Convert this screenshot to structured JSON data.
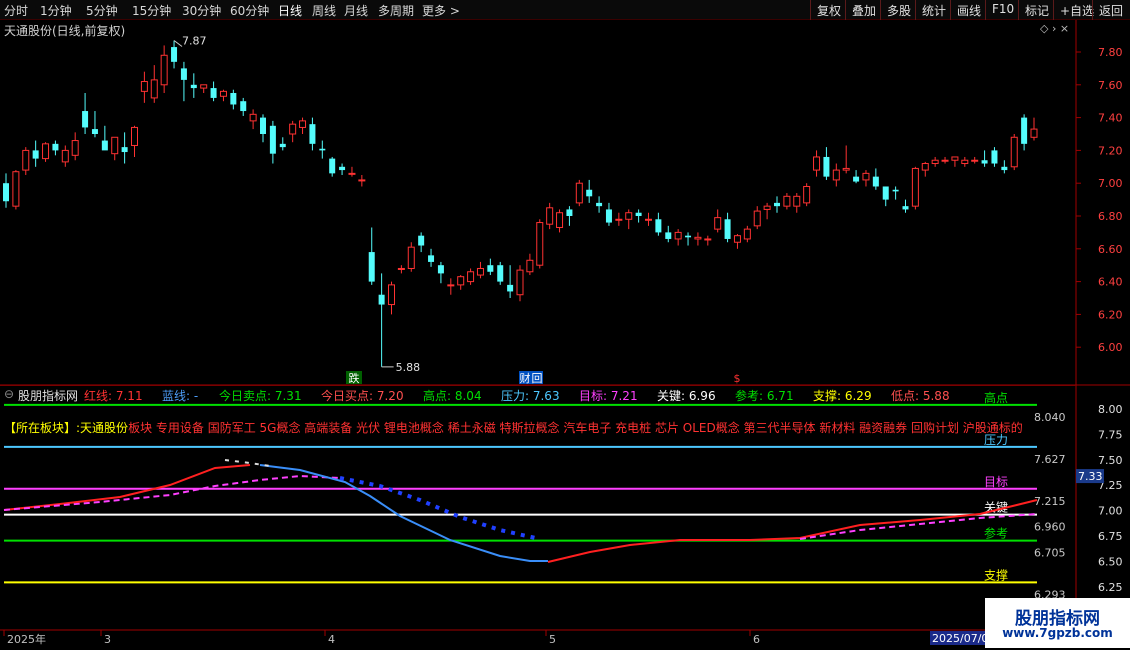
{
  "toolbar": {
    "left_items": [
      "分时",
      "1分钟",
      "5分钟",
      "15分钟",
      "30分钟",
      "60分钟",
      "日线",
      "周线",
      "月线",
      "多周期",
      "更多"
    ],
    "right_items": [
      "复权",
      "叠加",
      "多股",
      "统计",
      "画线",
      "F10",
      "标记",
      "+自选",
      "返回"
    ]
  },
  "main_chart": {
    "title": "天通股份(日线,前复权)",
    "y_ticks": [
      "7.80",
      "7.60",
      "7.40",
      "7.20",
      "7.00",
      "6.80",
      "6.60",
      "6.40",
      "6.20",
      "6.00"
    ],
    "high_mark": "7.87",
    "low_mark": "5.88",
    "event_markers": [
      "跌",
      "财",
      "回",
      "$"
    ],
    "colors": {
      "up": "#ff3232",
      "down": "#54fcfc",
      "axis": "#a00000"
    }
  },
  "indicator": {
    "name": "股朋指标网",
    "header": [
      {
        "label": "红线:",
        "value": "7.11",
        "color": "#ff3232"
      },
      {
        "label": "蓝线:",
        "value": "-",
        "color": "#4d9df8"
      },
      {
        "label": "今日卖点:",
        "value": "7.31",
        "color": "#00e000"
      },
      {
        "label": "今日买点:",
        "value": "7.20",
        "color": "#ff5050"
      },
      {
        "label": "高点:",
        "value": "8.04",
        "color": "#00e000"
      },
      {
        "label": "压力:",
        "value": "7.63",
        "color": "#4dc8ff"
      },
      {
        "label": "目标:",
        "value": "7.21",
        "color": "#ff40ff"
      },
      {
        "label": "关键:",
        "value": "6.96",
        "color": "#ffffff"
      },
      {
        "label": "参考:",
        "value": "6.71",
        "color": "#00e000"
      },
      {
        "label": "支撑:",
        "value": "6.29",
        "color": "#ffff00"
      },
      {
        "label": "低点:",
        "value": "5.88",
        "color": "#ff5050"
      }
    ],
    "sector_prefix": "【所在板块】:",
    "sector_stock": "天通股份",
    "sector_list": "板块 专用设备 国防军工 5G概念 高端装备 光伏 锂电池概念 稀土永磁 特斯拉概念 汽车电子 充电桩 芯片 OLED概念 第三代半导体 新材料 融资融券 回购计划 沪股通标的",
    "levels": [
      {
        "name": "高点",
        "value": "8.040",
        "color": "#00e000"
      },
      {
        "name": "压力",
        "value": "7.627",
        "color": "#4dc8ff"
      },
      {
        "name": "目标",
        "value": "7.215",
        "color": "#ff40ff"
      },
      {
        "name": "关键",
        "value": "6.960",
        "color": "#ffffff"
      },
      {
        "name": "参考",
        "value": "6.705",
        "color": "#00e000"
      },
      {
        "name": "支撑",
        "value": "6.293",
        "color": "#ffff00"
      }
    ],
    "y_ticks": [
      "8.00",
      "7.75",
      "7.50",
      "7.25",
      "7.00",
      "6.75",
      "6.50",
      "6.25"
    ],
    "current_value": "7.33"
  },
  "date_axis": {
    "labels": [
      "2025年",
      "3",
      "4",
      "5",
      "6"
    ],
    "current": "2025/07/0"
  },
  "watermark": {
    "name": "股朋指标网",
    "url": "www.7gpzb.com"
  }
}
